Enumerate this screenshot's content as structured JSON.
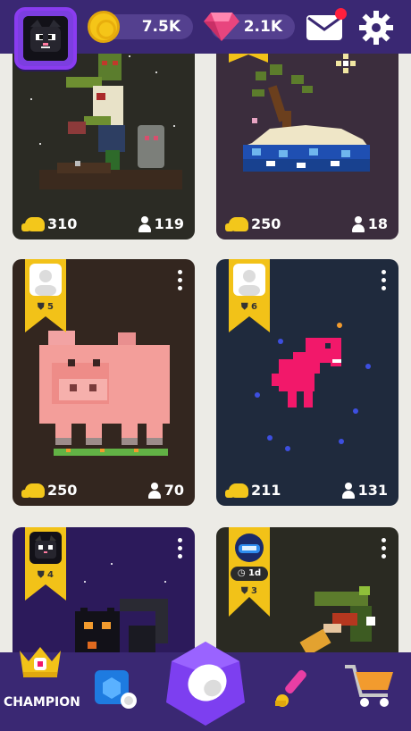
{
  "header": {
    "coins": "7.5K",
    "gems": "2.1K",
    "colors": {
      "bar": "#3a2873",
      "pill": "#54408f",
      "coin": "#f5c518",
      "gem": "#e8457e",
      "notification": "#ff1f3d"
    }
  },
  "cards": [
    {
      "id": "zombie",
      "likes": "310",
      "players": "119"
    },
    {
      "id": "island",
      "likes": "250",
      "players": "18"
    },
    {
      "id": "pig",
      "level": "5",
      "likes": "250",
      "players": "70"
    },
    {
      "id": "dino",
      "level": "6",
      "likes": "211",
      "players": "131"
    },
    {
      "id": "cat",
      "level": "4"
    },
    {
      "id": "dragon",
      "level": "3",
      "timer": "1d"
    }
  ],
  "nav": {
    "champion_label": "CHAMPION",
    "icons": [
      "crown-icon",
      "cube-icon",
      "play-icon",
      "paint-brush-icon",
      "cart-icon"
    ]
  }
}
